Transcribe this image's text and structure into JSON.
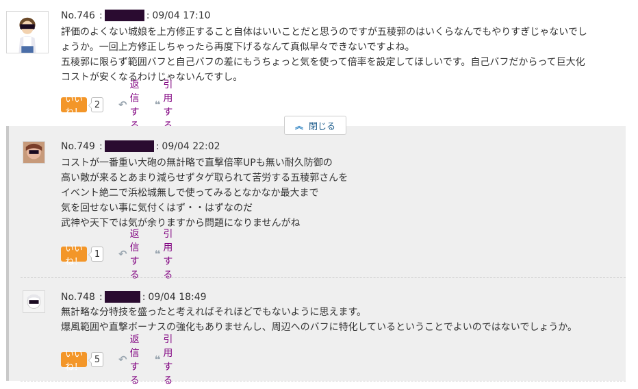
{
  "comments": [
    {
      "number": "No.746",
      "separator": ":",
      "datetime": "09/04 17:10",
      "body": "評価のよくない城娘を上方修正すること自体はいいことだと思うのですが五稜郭のはいくらなんでもやりすぎじゃないでし\nょうか。一回上方修正しちゃったら再度下げるなんて真似早々できないですよね。\n五稜郭に限らず範囲バフと自己バフの差にもうちょっと気を使って倍率を設定してほしいです。自己バフだからって巨大化\nコストが安くなるわけじゃないんですし。",
      "like_label": "いいね！",
      "like_count": "2",
      "reply_label": "返信する",
      "quote_label": "引用する"
    },
    {
      "number": "No.749",
      "separator": ":",
      "datetime": "09/04 22:02",
      "body": "コストが一番重い大砲の無計略で直撃倍率UPも無い耐久防御の\n高い敵が来るとあまり減らせずタゲ取られて苦労する五稜郭さんを\nイベント絶二で浜松城無しで使ってみるとなかなか最大まで\n気を回せない事に気付くはず・・はずなのだ\n武神や天下では気が余りますから問題になりませんがね",
      "like_label": "いいね！",
      "like_count": "1",
      "reply_label": "返信する",
      "quote_label": "引用する"
    },
    {
      "number": "No.748",
      "separator": ":",
      "datetime": "09/04 18:49",
      "body": "無計略な分特技を盛ったと考えればそれほどでもないように思えます。\n爆風範囲や直撃ボーナスの強化もありませんし、周辺へのバフに特化しているということでよいのではないでしょうか。",
      "like_label": "いいね！",
      "like_count": "5",
      "reply_label": "返信する",
      "quote_label": "引用する"
    }
  ],
  "thread": {
    "close_label": "閉じる"
  },
  "icons": {
    "reply": "reply-arrow-icon",
    "quote": "quote-mark-icon",
    "close": "chevron-up-icon"
  },
  "colors": {
    "like": "#f39629",
    "link": "#800080",
    "thread_bg": "#efefef",
    "redaction": "#2a0b30"
  }
}
